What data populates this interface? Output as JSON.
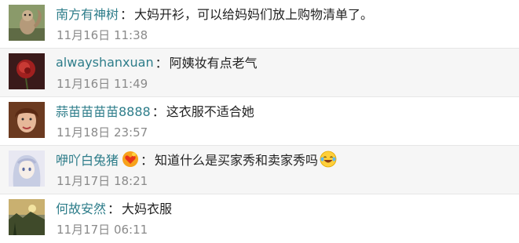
{
  "comments": [
    {
      "username": "南方有神树",
      "separator": "：",
      "text": "大妈开衫，可以给妈妈们放上购物清单了。",
      "time": "11月16日 11:38",
      "avatar_icon": "squirrel-avatar"
    },
    {
      "username": "alwayshanxuan",
      "separator": "：",
      "text": "阿姨妆有点老气",
      "time": "11月16日 11:49",
      "avatar_icon": "red-flower-avatar"
    },
    {
      "username": "蒜苗苗苗苗8888",
      "separator": "：",
      "text": "这衣服不适合她",
      "time": "11月18日 23:57",
      "avatar_icon": "woman-portrait-avatar"
    },
    {
      "username": "咿吖白兔猪",
      "separator": "：",
      "text": "知道什么是买家秀和卖家秀吗",
      "time": "11月17日 18:21",
      "avatar_icon": "anime-girl-avatar",
      "badge_icon": "heart-badge-icon",
      "trailing_emoji": "laughing-tears-emoji"
    },
    {
      "username": "何故安然",
      "separator": "：",
      "text": "大妈衣服",
      "time": "11月17日 06:11",
      "avatar_icon": "sunset-landscape-avatar"
    }
  ],
  "colors": {
    "username": "#2e7d8a",
    "text": "#222222",
    "time": "#8a8a8a",
    "row_alt_background": "#f6f6f6"
  }
}
